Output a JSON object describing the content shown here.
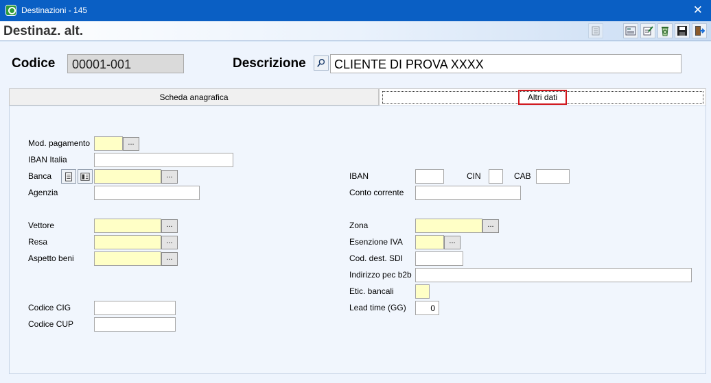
{
  "window": {
    "title": "Destinazioni - 145",
    "close_glyph": "✕"
  },
  "header": {
    "title": "Destinaz. alt."
  },
  "toolbar": [
    {
      "icon": "list-icon"
    },
    {
      "icon": "report-icon"
    },
    {
      "icon": "edit-doc-icon"
    },
    {
      "icon": "recycle-icon"
    },
    {
      "icon": "save-icon"
    },
    {
      "icon": "exit-icon"
    }
  ],
  "record": {
    "codice_label": "Codice",
    "codice_value": "00001-001",
    "descrizione_label": "Descrizione",
    "descrizione_value": "CLIENTE DI PROVA XXXX"
  },
  "tabs": [
    {
      "label": "Scheda anagrafica",
      "active": false
    },
    {
      "label": "Altri dati",
      "active": true
    }
  ],
  "form": {
    "mod_pagamento": {
      "label": "Mod. pagamento",
      "value": ""
    },
    "iban_italia": {
      "label": "IBAN Italia",
      "value": ""
    },
    "banca": {
      "label": "Banca",
      "value": ""
    },
    "agenzia": {
      "label": "Agenzia",
      "value": ""
    },
    "vettore": {
      "label": "Vettore",
      "value": ""
    },
    "resa": {
      "label": "Resa",
      "value": ""
    },
    "aspetto_beni": {
      "label": "Aspetto beni",
      "value": ""
    },
    "codice_cig": {
      "label": "Codice CIG",
      "value": ""
    },
    "codice_cup": {
      "label": "Codice CUP",
      "value": ""
    },
    "iban": {
      "label": "IBAN",
      "value": ""
    },
    "cin": {
      "label": "CIN",
      "value": ""
    },
    "cab": {
      "label": "CAB",
      "value": ""
    },
    "conto_corrente": {
      "label": "Conto corrente",
      "value": ""
    },
    "zona": {
      "label": "Zona",
      "value": ""
    },
    "esenzione_iva": {
      "label": "Esenzione IVA",
      "value": ""
    },
    "cod_dest_sdi": {
      "label": "Cod. dest. SDI",
      "value": ""
    },
    "indirizzo_pec": {
      "label": "Indirizzo pec b2b",
      "value": ""
    },
    "etic_bancali": {
      "label": "Etic. bancali",
      "value": ""
    },
    "lead_time": {
      "label": "Lead time (GG)",
      "value": "0"
    },
    "lookup_glyph": "..."
  },
  "colors": {
    "titlebar": "#0a5fc4",
    "highlight_border": "#d0161c",
    "required_field": "#ffffc6"
  }
}
